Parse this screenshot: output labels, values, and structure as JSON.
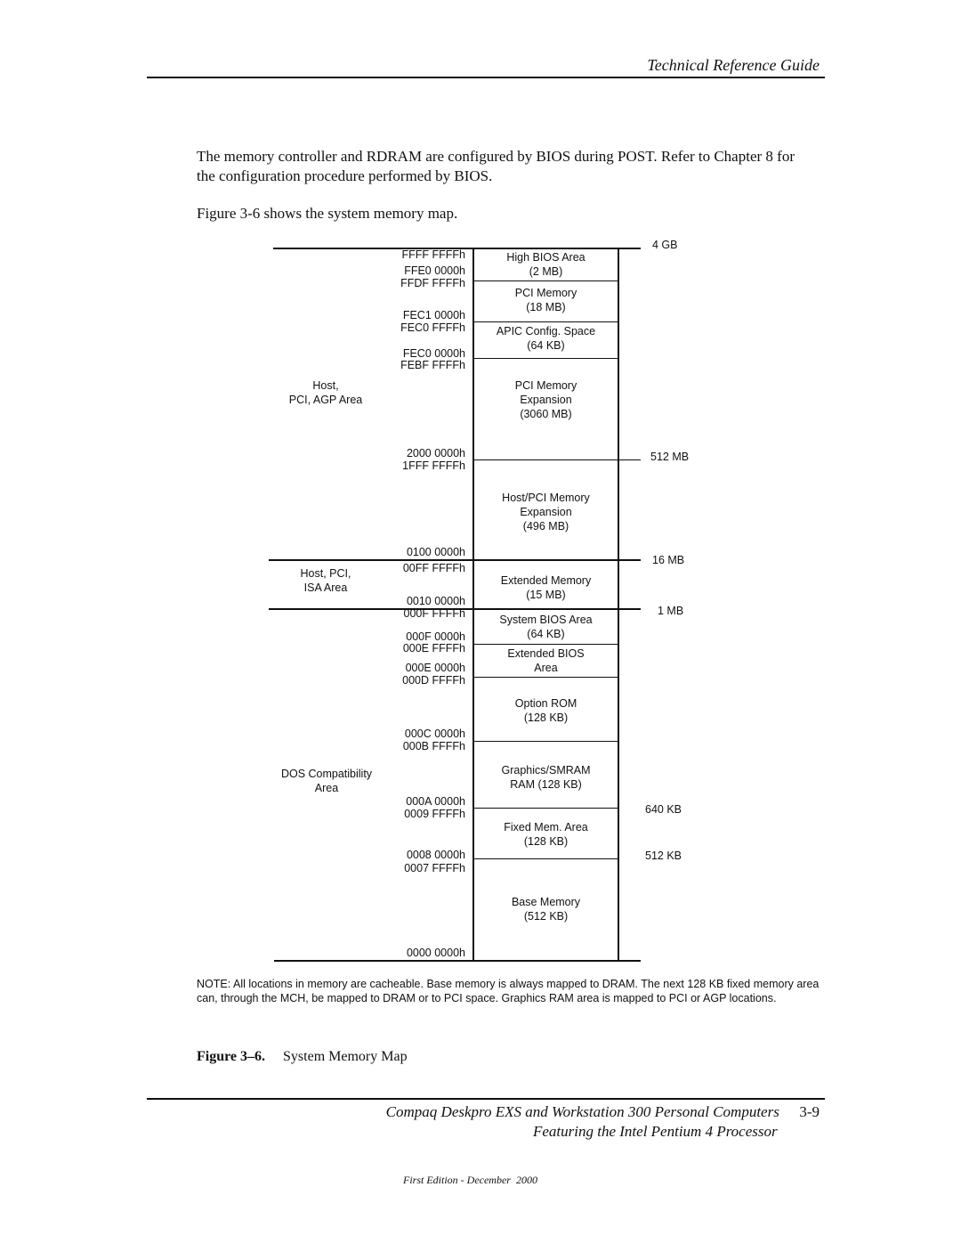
{
  "header": {
    "title": "Technical Reference Guide"
  },
  "body": {
    "paragraph_1_line_1": "The memory controller and RDRAM are configured by BIOS during POST. Refer to Chapter 8 for",
    "paragraph_1_line_2": "the configuration procedure performed by BIOS.",
    "paragraph_2": "Figure 3-6 shows the system memory map."
  },
  "memory_map": {
    "regions": [
      {
        "name": "High BIOS Area",
        "size": "(2 MB)",
        "top_addr": "FFFF FFFFh",
        "bottom_addr": "FFE0 0000h"
      },
      {
        "name": "PCI Memory",
        "size": "(18 MB)",
        "top_addr": "FFDF FFFFh",
        "bottom_addr": "FEC1 0000h"
      },
      {
        "name": "APIC Config. Space",
        "size": "(64 KB)",
        "top_addr": "FEC0 FFFFh",
        "bottom_addr": "FEC0 0000h"
      },
      {
        "name": "PCI Memory",
        "name2": "Expansion",
        "size": "(3060 MB)",
        "top_addr": "FEBF FFFFh",
        "bottom_addr": "2000 0000h"
      },
      {
        "name": "Host/PCI Memory",
        "name2": "Expansion",
        "size": "(496 MB)",
        "top_addr": "1FFF FFFFh",
        "bottom_addr": "0100 0000h"
      },
      {
        "name": "Extended Memory",
        "size": "(15 MB)",
        "top_addr": "00FF FFFFh",
        "bottom_addr": "0010 0000h"
      },
      {
        "name": "System BIOS Area",
        "size": "(64 KB)",
        "top_addr": "000F FFFFh",
        "bottom_addr": "000F 0000h"
      },
      {
        "name": "Extended BIOS",
        "size": "Area",
        "top_addr": "000E FFFFh",
        "bottom_addr": "000E 0000h"
      },
      {
        "name": "Option ROM",
        "size": "(128 KB)",
        "top_addr": "000D FFFFh",
        "bottom_addr": "000C 0000h"
      },
      {
        "name": "Graphics/SMRAM",
        "size": "RAM (128 KB)",
        "top_addr": "000B FFFFh",
        "bottom_addr": "000A 0000h"
      },
      {
        "name": "Fixed Mem. Area",
        "size": "(128 KB)",
        "top_addr": "0009 FFFFh",
        "bottom_addr": "0008 0000h"
      },
      {
        "name": "Base Memory",
        "size": "(512 KB)",
        "top_addr": "0007 FFFFh",
        "bottom_addr": "0000 0000h"
      }
    ],
    "boundaries": [
      "4 GB",
      "512 MB",
      "16 MB",
      "1 MB",
      "640 KB",
      "512 KB"
    ],
    "areas": [
      {
        "line1": "Host,",
        "line2": "PCI, AGP Area"
      },
      {
        "line1": "Host, PCI,",
        "line2": "ISA Area"
      },
      {
        "line1": "DOS Compatibility",
        "line2": "Area"
      }
    ]
  },
  "note": "NOTE: All locations in memory are cacheable. Base memory is always mapped to DRAM. The next 128 KB fixed memory area can, through the MCH, be mapped to DRAM or to PCI space. Graphics RAM area is mapped to PCI or AGP locations.",
  "caption": {
    "label": "Figure 3–6.",
    "title": "System Memory Map"
  },
  "footer": {
    "line1": "Compaq Deskpro EXS and Workstation 300 Personal Computers",
    "page": "3-9",
    "line2": "Featuring the Intel Pentium 4 Processor",
    "edition": "First Edition - December  2000"
  }
}
